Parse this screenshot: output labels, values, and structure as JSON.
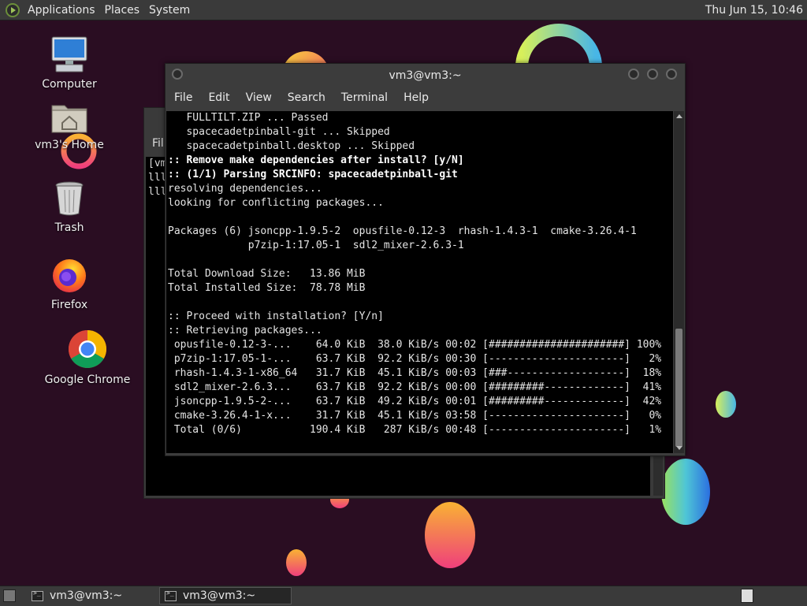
{
  "top_panel": {
    "menus": [
      "Applications",
      "Places",
      "System"
    ],
    "clock": "Thu Jun 15, 10:46"
  },
  "desktop": {
    "icons": [
      {
        "label": "Computer",
        "icon": "computer-icon"
      },
      {
        "label": "vm3's Home",
        "icon": "home-folder-icon"
      },
      {
        "label": "Trash",
        "icon": "trash-icon"
      },
      {
        "label": "Firefox",
        "icon": "firefox-icon"
      },
      {
        "label": "Google Chrome",
        "icon": "chrome-icon"
      }
    ]
  },
  "back_window": {
    "menu_first": "Fil",
    "lines": [
      "[vm",
      "lll",
      "lll"
    ]
  },
  "window": {
    "title": "vm3@vm3:~",
    "menus": [
      "File",
      "Edit",
      "View",
      "Search",
      "Terminal",
      "Help"
    ]
  },
  "terminal": {
    "lines": [
      {
        "text": "   FULLTILT.ZIP ... Passed",
        "bold": false
      },
      {
        "text": "   spacecadetpinball-git ... Skipped",
        "bold": false
      },
      {
        "text": "   spacecadetpinball.desktop ... Skipped",
        "bold": false
      },
      {
        "text": ":: Remove make dependencies after install? [y/N]",
        "bold": true
      },
      {
        "text": ":: (1/1) Parsing SRCINFO: spacecadetpinball-git",
        "bold": true
      },
      {
        "text": "resolving dependencies...",
        "bold": false
      },
      {
        "text": "looking for conflicting packages...",
        "bold": false
      },
      {
        "text": "",
        "bold": false
      },
      {
        "text": "Packages (6) jsoncpp-1.9.5-2  opusfile-0.12-3  rhash-1.4.3-1  cmake-3.26.4-1",
        "bold": false
      },
      {
        "text": "             p7zip-1:17.05-1  sdl2_mixer-2.6.3-1",
        "bold": false
      },
      {
        "text": "",
        "bold": false
      },
      {
        "text": "Total Download Size:   13.86 MiB",
        "bold": false
      },
      {
        "text": "Total Installed Size:  78.78 MiB",
        "bold": false
      },
      {
        "text": "",
        "bold": false
      },
      {
        "text": ":: Proceed with installation? [Y/n]",
        "bold": false
      },
      {
        "text": ":: Retrieving packages...",
        "bold": false
      },
      {
        "text": " opusfile-0.12-3-...    64.0 KiB  38.0 KiB/s 00:02 [######################] 100%",
        "bold": false
      },
      {
        "text": " p7zip-1:17.05-1-...    63.7 KiB  92.2 KiB/s 00:30 [----------------------]   2%",
        "bold": false
      },
      {
        "text": " rhash-1.4.3-1-x86_64   31.7 KiB  45.1 KiB/s 00:03 [###-------------------]  18%",
        "bold": false
      },
      {
        "text": " sdl2_mixer-2.6.3...    63.7 KiB  92.2 KiB/s 00:00 [#########-------------]  41%",
        "bold": false
      },
      {
        "text": " jsoncpp-1.9.5-2-...    63.7 KiB  49.2 KiB/s 00:01 [#########-------------]  42%",
        "bold": false
      },
      {
        "text": " cmake-3.26.4-1-x...    31.7 KiB  45.1 KiB/s 03:58 [----------------------]   0%",
        "bold": false
      },
      {
        "text": " Total (0/6)           190.4 KiB   287 KiB/s 00:48 [----------------------]   1%",
        "bold": false
      }
    ]
  },
  "taskbar": {
    "tasks": [
      {
        "label": "vm3@vm3:~",
        "active": false
      },
      {
        "label": "vm3@vm3:~",
        "active": true
      }
    ]
  },
  "colors": {
    "desktop_bg": "#2a0d22",
    "panel_bg": "#3a3a3a",
    "terminal_bg": "#000000",
    "terminal_fg": "#e5e5e5"
  }
}
